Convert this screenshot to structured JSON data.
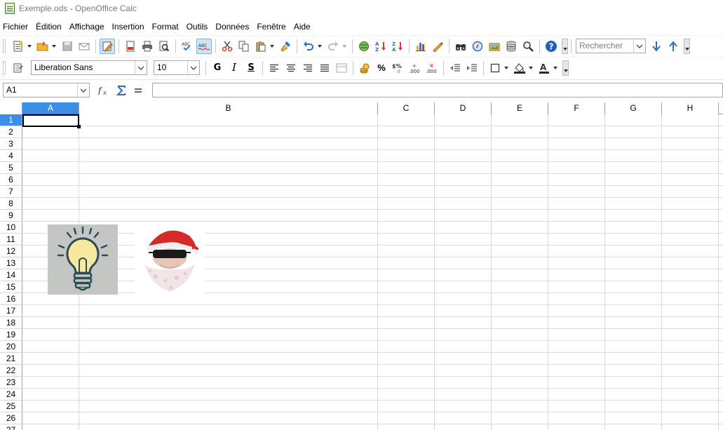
{
  "window": {
    "title": "Exemple.ods - OpenOffice Calc"
  },
  "menu": {
    "items": [
      {
        "label": "Fichier"
      },
      {
        "label": "Édition"
      },
      {
        "label": "Affichage"
      },
      {
        "label": "Insertion"
      },
      {
        "label": "Format"
      },
      {
        "label": "Outils"
      },
      {
        "label": "Données"
      },
      {
        "label": "Fenêtre"
      },
      {
        "label": "Aide"
      }
    ]
  },
  "toolbar_standard": {
    "search_placeholder": "Rechercher"
  },
  "toolbar_format": {
    "font_name": "Liberation Sans",
    "font_size": "10",
    "bold_label": "G",
    "italic_label": "I",
    "underline_label": "S",
    "percent_label": "%"
  },
  "formula_bar": {
    "name_box": "A1",
    "formula_content": ""
  },
  "sheet": {
    "selected_cell": "A1",
    "columns": [
      "A",
      "B",
      "C",
      "D",
      "E",
      "F",
      "G",
      "H"
    ],
    "rows": [
      "1",
      "2",
      "3",
      "4",
      "5",
      "6",
      "7",
      "8",
      "9",
      "10",
      "11",
      "12",
      "13",
      "14",
      "15",
      "16",
      "17",
      "18",
      "19",
      "20",
      "21",
      "22",
      "23",
      "24",
      "25",
      "26",
      "27"
    ],
    "images": [
      {
        "name": "lightbulb-image"
      },
      {
        "name": "santa-sunglasses-image"
      }
    ]
  }
}
